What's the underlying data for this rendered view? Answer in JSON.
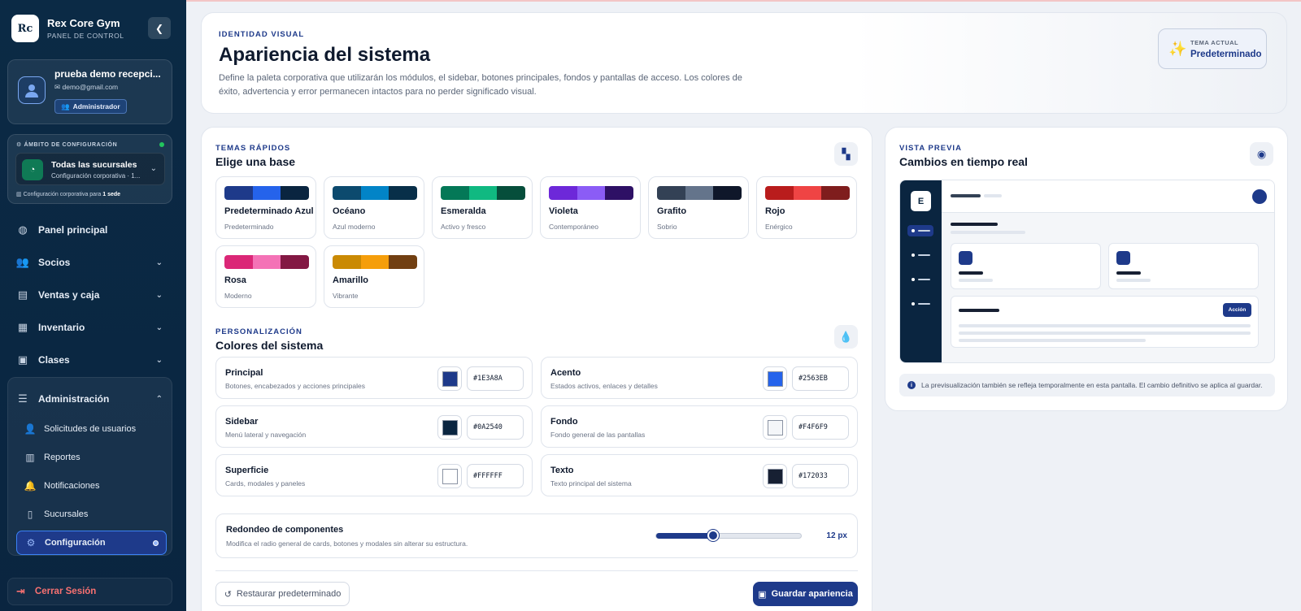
{
  "sidebar": {
    "brand_title": "Rex Core Gym",
    "brand_sub": "PANEL DE CONTROL",
    "logo_text": "Rc",
    "user": {
      "name": "prueba demo recepci...",
      "email": "demo@gmail.com",
      "role": "Administrador"
    },
    "scope": {
      "label": "ÁMBITO DE CONFIGURACIÓN",
      "title": "Todas las sucursales",
      "subtitle": "Configuración corporativa · 1...",
      "footer_prefix": "Configuración corporativa para",
      "footer_value": "1 sede"
    },
    "nav": [
      {
        "label": "Panel principal",
        "icon": "gauge-icon"
      },
      {
        "label": "Socios",
        "icon": "users-icon"
      },
      {
        "label": "Ventas y caja",
        "icon": "cash-register-icon"
      },
      {
        "label": "Inventario",
        "icon": "boxes-icon"
      },
      {
        "label": "Clases",
        "icon": "calendar-icon"
      },
      {
        "label": "Administración",
        "icon": "sliders-icon"
      }
    ],
    "admin_items": [
      {
        "label": "Solicitudes de usuarios",
        "icon": "user-cog-icon"
      },
      {
        "label": "Reportes",
        "icon": "chart-icon"
      },
      {
        "label": "Notificaciones",
        "icon": "bell-icon"
      },
      {
        "label": "Sucursales",
        "icon": "building-icon"
      },
      {
        "label": "Configuración",
        "icon": "gear-icon"
      }
    ],
    "logout": "Cerrar Sesión"
  },
  "header": {
    "eyebrow": "IDENTIDAD VISUAL",
    "title": "Apariencia del sistema",
    "description": "Define la paleta corporativa que utilizarán los módulos, el sidebar, botones principales, fondos y pantallas de acceso. Los colores de éxito, advertencia y error permanecen intactos para no perder significado visual.",
    "theme_label": "TEMA ACTUAL",
    "theme_value": "Predeterminado"
  },
  "quick_themes": {
    "eyebrow": "TEMAS RÁPIDOS",
    "title": "Elige una base",
    "presets": [
      {
        "name": "Predeterminado Azul",
        "desc": "Predeterminado",
        "colors": [
          "#1e3a8a",
          "#2563eb",
          "#0a2540"
        ]
      },
      {
        "name": "Océano",
        "desc": "Azul moderno",
        "colors": [
          "#0c4a6e",
          "#0284c7",
          "#082f49"
        ]
      },
      {
        "name": "Esmeralda",
        "desc": "Activo y fresco",
        "colors": [
          "#047857",
          "#10b981",
          "#064e3b"
        ]
      },
      {
        "name": "Violeta",
        "desc": "Contemporáneo",
        "colors": [
          "#6d28d9",
          "#8b5cf6",
          "#2e1065"
        ]
      },
      {
        "name": "Grafito",
        "desc": "Sobrio",
        "colors": [
          "#334155",
          "#64748b",
          "#0f172a"
        ]
      },
      {
        "name": "Rojo",
        "desc": "Enérgico",
        "colors": [
          "#b91c1c",
          "#ef4444",
          "#7f1d1d"
        ]
      },
      {
        "name": "Rosa",
        "desc": "Moderno",
        "colors": [
          "#db2777",
          "#f472b6",
          "#831843"
        ]
      },
      {
        "name": "Amarillo",
        "desc": "Vibrante",
        "colors": [
          "#ca8a04",
          "#f59e0b",
          "#713f12"
        ]
      }
    ]
  },
  "custom": {
    "eyebrow": "PERSONALIZACIÓN",
    "title": "Colores del sistema",
    "colors": [
      {
        "name": "Principal",
        "desc": "Botones, encabezados y acciones principales",
        "hex": "#1E3A8A"
      },
      {
        "name": "Acento",
        "desc": "Estados activos, enlaces y detalles",
        "hex": "#2563EB"
      },
      {
        "name": "Sidebar",
        "desc": "Menú lateral y navegación",
        "hex": "#0A2540"
      },
      {
        "name": "Fondo",
        "desc": "Fondo general de las pantallas",
        "hex": "#F4F6F9"
      },
      {
        "name": "Superficie",
        "desc": "Cards, modales y paneles",
        "hex": "#FFFFFF"
      },
      {
        "name": "Texto",
        "desc": "Texto principal del sistema",
        "hex": "#172033"
      }
    ],
    "radius": {
      "title": "Redondeo de componentes",
      "desc": "Modifica el radio general de cards, botones y modales sin alterar su estructura.",
      "value_label": "12 px",
      "fraction": 0.39
    },
    "restore_label": "Restaurar predeterminado",
    "save_label": "Guardar apariencia"
  },
  "preview": {
    "eyebrow": "VISTA PREVIA",
    "title": "Cambios en tiempo real",
    "logo": "E",
    "action_label": "Acción",
    "note": "La previsualización también se refleja temporalmente en esta pantalla. El cambio definitivo se aplica al guardar."
  }
}
